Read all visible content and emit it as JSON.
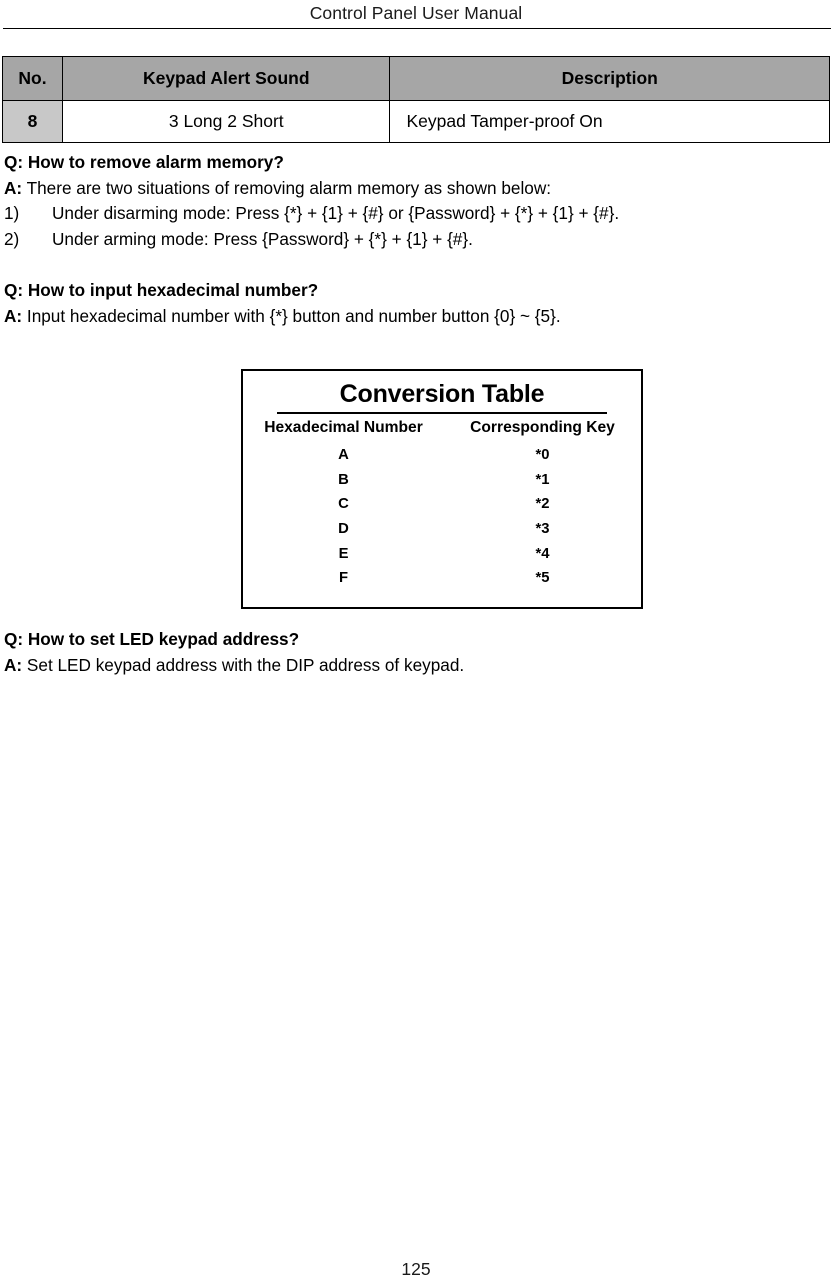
{
  "header": {
    "running_title": "Control Panel User Manual"
  },
  "alert_table": {
    "columns": [
      "No.",
      "Keypad Alert Sound",
      "Description"
    ],
    "rows": [
      {
        "no": "8",
        "sound": "3 Long 2 Short",
        "description": "Keypad Tamper-proof On"
      }
    ],
    "header_bg": "#A6A6A6",
    "no_cell_bg": "#C8C8C8"
  },
  "faq": [
    {
      "question_prefix": "Q:",
      "question": " How to remove alarm memory?",
      "answer_prefix": "A:",
      "answer": " There are two situations of removing alarm memory as shown below:",
      "steps": [
        {
          "marker": "1)",
          "text": "Under disarming mode: Press {*} + {1} + {#} or {Password} + {*} + {1} + {#}."
        },
        {
          "marker": "2)",
          "text": "Under arming mode: Press {Password} + {*} + {1} + {#}."
        }
      ]
    },
    {
      "question_prefix": "Q:",
      "question": " How to input hexadecimal number?",
      "answer_prefix": "A:",
      "answer": " Input hexadecimal number with {*} button and number button {0} ~ {5}.",
      "steps": []
    }
  ],
  "conversion_table": {
    "title": "Conversion Table",
    "columns": [
      "Hexadecimal Number",
      "Corresponding Key"
    ],
    "rows": [
      {
        "hex": "A",
        "key": "*0"
      },
      {
        "hex": "B",
        "key": "*1"
      },
      {
        "hex": "C",
        "key": "*2"
      },
      {
        "hex": "D",
        "key": "*3"
      },
      {
        "hex": "E",
        "key": "*4"
      },
      {
        "hex": "F",
        "key": "*5"
      }
    ]
  },
  "faq_bottom": {
    "question_prefix": "Q:",
    "question": " How to set LED keypad address?",
    "answer_prefix": "A:",
    "answer": " Set LED keypad address with the DIP address of keypad."
  },
  "footer": {
    "page_number": "125"
  }
}
